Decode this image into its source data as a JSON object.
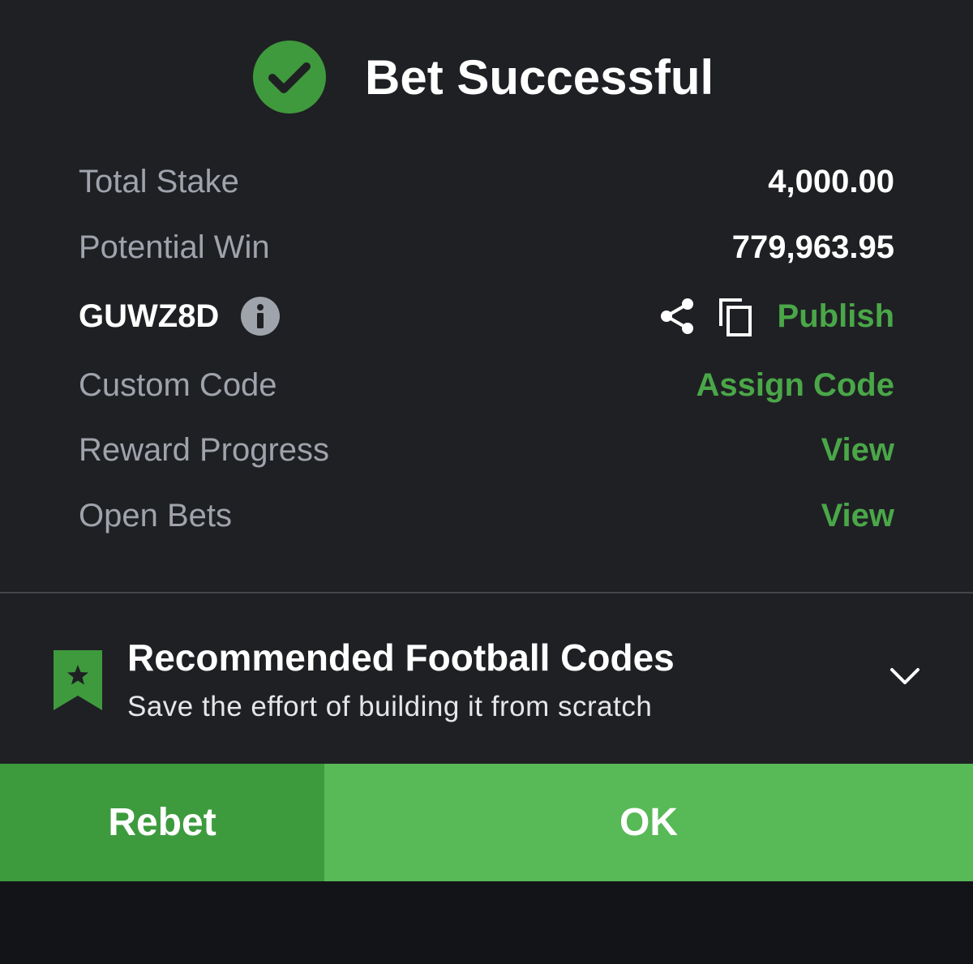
{
  "header": {
    "title": "Bet Successful",
    "icon": "check-circle-icon"
  },
  "details": {
    "total_stake_label": "Total Stake",
    "total_stake_value": "4,000.00",
    "potential_win_label": "Potential Win",
    "potential_win_value": "779,963.95",
    "booking_code": "GUWZ8D",
    "publish_label": "Publish",
    "custom_code_label": "Custom Code",
    "assign_code_label": "Assign Code",
    "reward_progress_label": "Reward Progress",
    "reward_progress_action": "View",
    "open_bets_label": "Open Bets",
    "open_bets_action": "View"
  },
  "recommended": {
    "title": "Recommended Football Codes",
    "subtitle": "Save the effort of building it from scratch",
    "icon": "bookmark-star-icon"
  },
  "buttons": {
    "rebet_label": "Rebet",
    "ok_label": "OK"
  },
  "colors": {
    "background": "#1f2024",
    "accent_green": "#4aa748",
    "check_green": "#3f9a3d",
    "rebet_green": "#3d9b3e",
    "ok_green": "#58b957",
    "label_gray": "#9fa3ab"
  }
}
